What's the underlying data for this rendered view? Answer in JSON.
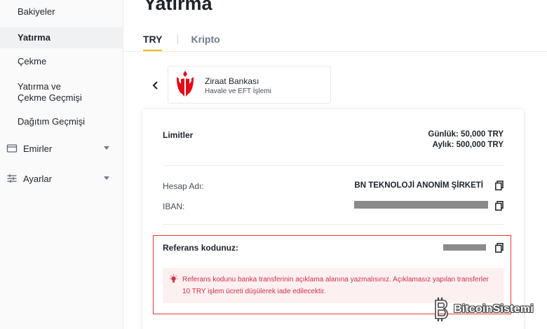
{
  "sidebar": {
    "items": [
      {
        "label": "Bakiyeler"
      },
      {
        "label": "Yatırma"
      },
      {
        "label": "Çekme"
      },
      {
        "label": "Yatırma ve Çekme Geçmişi"
      },
      {
        "label": "Dağıtım Geçmişi"
      }
    ],
    "groups": [
      {
        "label": "Emirler",
        "icon": "orders-icon"
      },
      {
        "label": "Ayarlar",
        "icon": "settings-sliders-icon"
      }
    ]
  },
  "main": {
    "title": "Yatırma",
    "tabs": [
      {
        "label": "TRY",
        "active": true
      },
      {
        "label": "Kripto",
        "active": false
      }
    ]
  },
  "bank": {
    "name": "Ziraat Bankası",
    "subtitle": "Havale ve EFT İşlemi",
    "logo_color": "#e30a17"
  },
  "limits": {
    "label": "Limitler",
    "daily": "Günlük: 50,000 TRY",
    "monthly": "Aylık: 500,000 TRY"
  },
  "account": {
    "name_label": "Hesap Adı:",
    "name_value": "BN TEKNOLOJİ ANONİM ŞİRKETİ",
    "iban_label": "IBAN:"
  },
  "reference": {
    "label": "Referans kodunuz:",
    "warning": "Referans kodunu banka transferinin açıklama alanına yazmalısınız. Açıklamasız yapılan transferler 10 TRY işlem ücreti düşülerek iade edilecektir."
  },
  "watermark": {
    "text": "BitcoinSistemi"
  },
  "colors": {
    "accent": "#f0b90b",
    "warning_text": "#cf304a",
    "warning_bg": "#fdf0f1",
    "highlight_border": "#e53935"
  }
}
